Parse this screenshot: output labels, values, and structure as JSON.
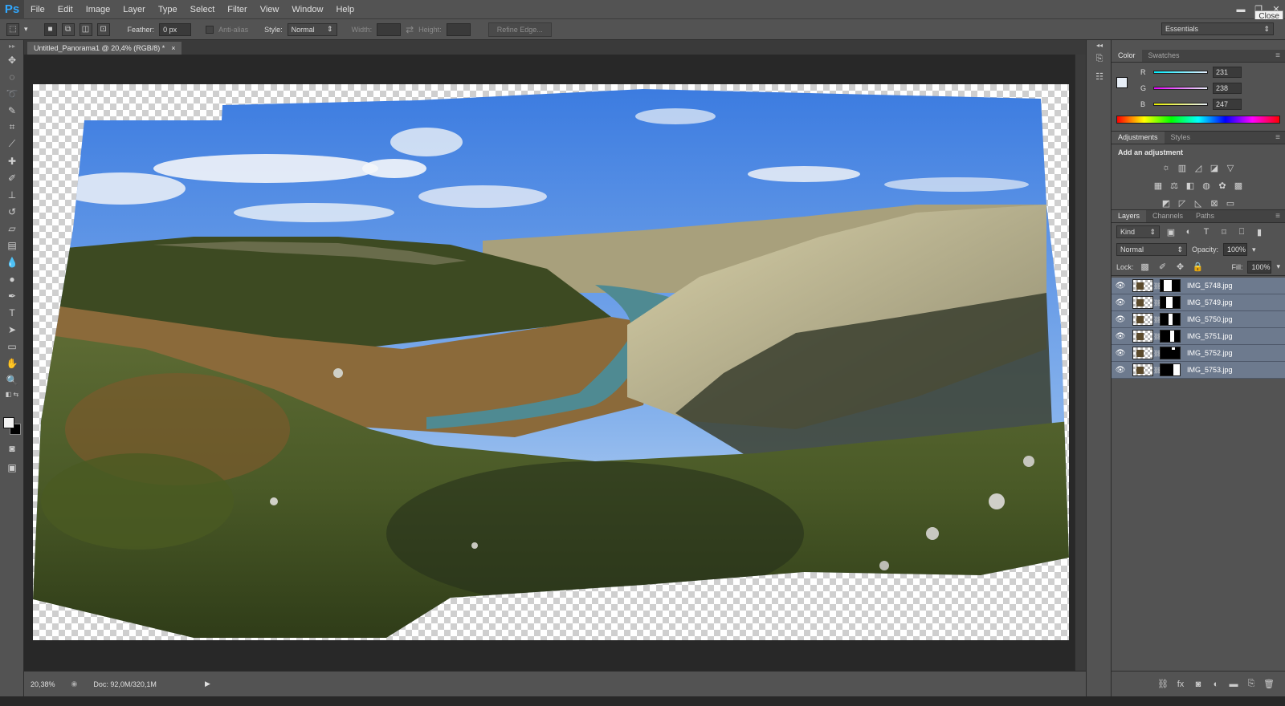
{
  "app": {
    "logo": "Ps",
    "menus": [
      "File",
      "Edit",
      "Image",
      "Layer",
      "Type",
      "Select",
      "Filter",
      "View",
      "Window",
      "Help"
    ],
    "window_controls": {
      "minimize": "▬",
      "restore": "❐",
      "close": "✕"
    },
    "close_tooltip": "Close"
  },
  "options": {
    "feather_label": "Feather:",
    "feather_value": "0 px",
    "antialias_label": "Anti-alias",
    "style_label": "Style:",
    "style_value": "Normal",
    "width_label": "Width:",
    "height_label": "Height:",
    "refine_edge": "Refine Edge...",
    "workspace": "Essentials"
  },
  "document": {
    "tab_title": "Untitled_Panorama1 @ 20,4% (RGB/8) *",
    "tab_close": "×",
    "zoom": "20,38%",
    "doc_info": "Doc: 92,0M/320,1M"
  },
  "color_panel": {
    "tabs": [
      "Color",
      "Swatches"
    ],
    "channels": [
      {
        "label": "R",
        "value": "231",
        "gradient": "linear-gradient(to right,#00eeff,#e7eeff)"
      },
      {
        "label": "G",
        "value": "238",
        "gradient": "linear-gradient(to right,#e700ff,#e7eef7)"
      },
      {
        "label": "B",
        "value": "247",
        "gradient": "linear-gradient(to right,#e7ee00,#e7eef7)"
      }
    ]
  },
  "adjustments_panel": {
    "tabs": [
      "Adjustments",
      "Styles"
    ],
    "title": "Add an adjustment"
  },
  "layers_panel": {
    "tabs": [
      "Layers",
      "Channels",
      "Paths"
    ],
    "filter_kind": "Kind",
    "blend_mode": "Normal",
    "opacity_label": "Opacity:",
    "opacity_value": "100%",
    "lock_label": "Lock:",
    "fill_label": "Fill:",
    "fill_value": "100%",
    "layers": [
      {
        "name": "IMG_5748.jpg"
      },
      {
        "name": "IMG_5749.jpg"
      },
      {
        "name": "IMG_5750.jpg"
      },
      {
        "name": "IMG_5751.jpg"
      },
      {
        "name": "IMG_5752.jpg"
      },
      {
        "name": "IMG_5753.jpg"
      }
    ]
  }
}
